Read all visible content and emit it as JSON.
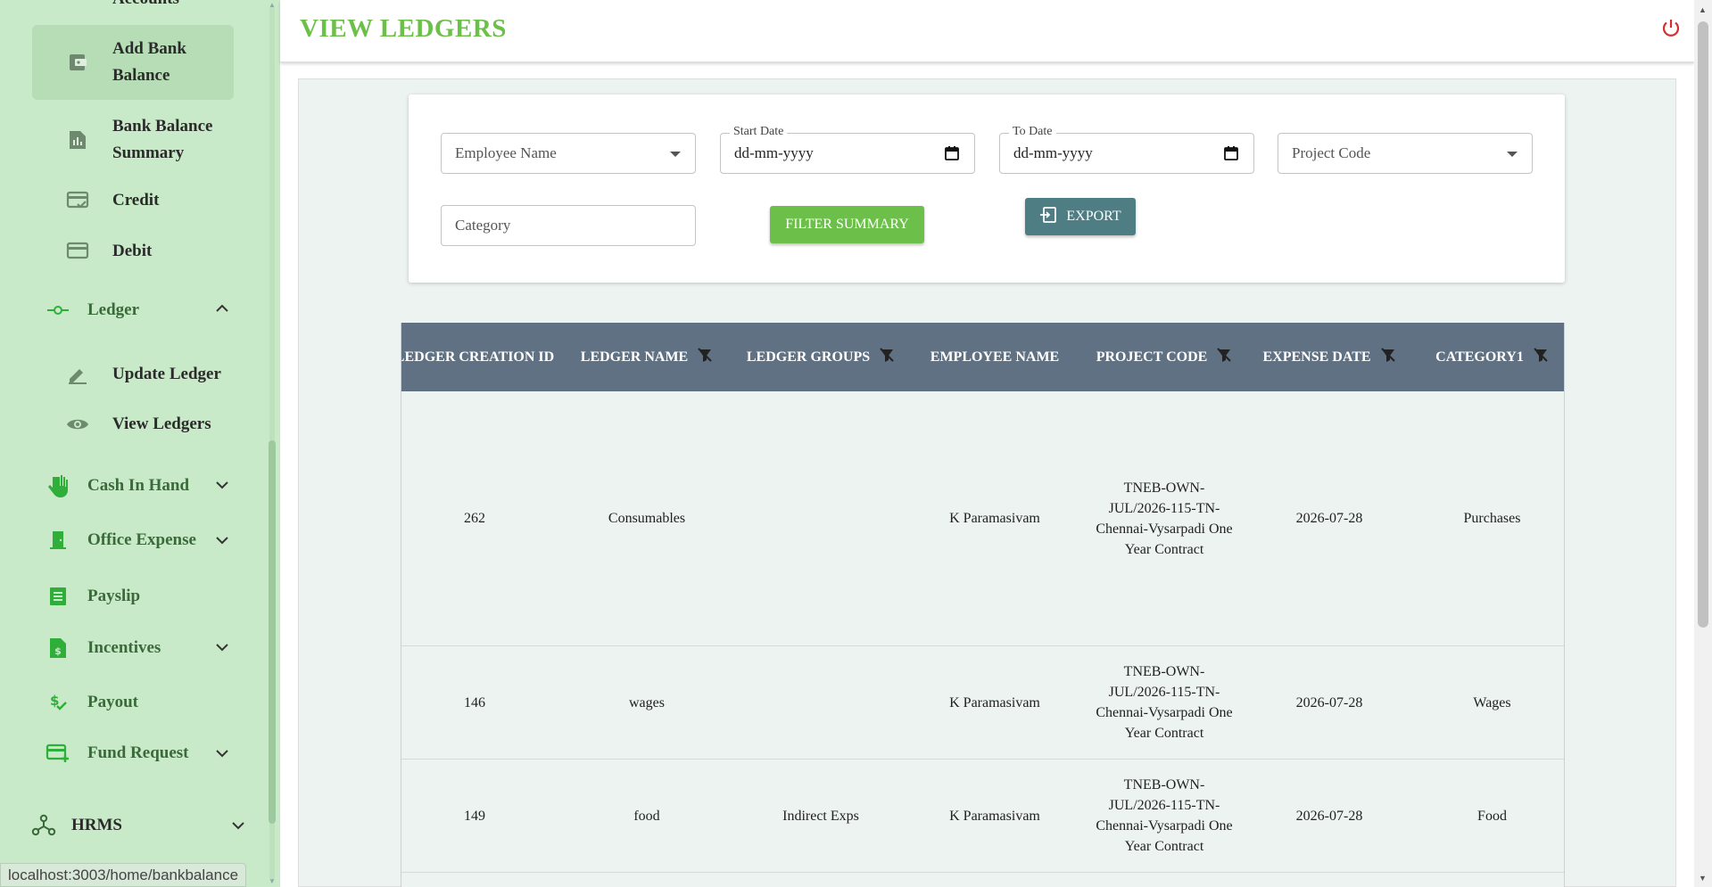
{
  "sidebar": {
    "items": [
      {
        "label": "Accounts",
        "icon": "accounts-icon"
      },
      {
        "label": "Add Bank Balance",
        "icon": "wallet-icon"
      },
      {
        "label": "Bank Balance Summary",
        "icon": "summary-icon"
      },
      {
        "label": "Credit",
        "icon": "credit-card-check-icon"
      },
      {
        "label": "Debit",
        "icon": "credit-card-icon"
      },
      {
        "label": "Ledger",
        "icon": "commit-icon"
      },
      {
        "label": "Update Ledger",
        "icon": "edit-icon"
      },
      {
        "label": "View Ledgers",
        "icon": "eye-icon"
      },
      {
        "label": "Cash In Hand",
        "icon": "hand-icon"
      },
      {
        "label": "Office Expense",
        "icon": "door-icon"
      },
      {
        "label": "Payslip",
        "icon": "receipt-icon"
      },
      {
        "label": "Incentives",
        "icon": "dollar-file-icon"
      },
      {
        "label": "Payout",
        "icon": "payout-icon"
      },
      {
        "label": "Fund Request",
        "icon": "card-plus-icon"
      },
      {
        "label": "HRMS",
        "icon": "people-network-icon"
      }
    ]
  },
  "status_url": "localhost:3003/home/bankbalance",
  "header": {
    "title": "VIEW LEDGERS",
    "power_icon": "power-icon"
  },
  "filters": {
    "employee_name": {
      "placeholder": "Employee Name"
    },
    "start_date": {
      "label": "Start Date",
      "value": "dd-mm-yyyy"
    },
    "to_date": {
      "label": "To Date",
      "value": "dd-mm-yyyy"
    },
    "project_code": {
      "placeholder": "Project Code"
    },
    "category": {
      "placeholder": "Category"
    },
    "filter_button": "FILTER SUMMARY",
    "export_button": "EXPORT"
  },
  "table": {
    "columns": [
      "LEDGER CREATION ID",
      "LEDGER NAME",
      "LEDGER GROUPS",
      "EMPLOYEE NAME",
      "PROJECT CODE",
      "EXPENSE DATE",
      "CATEGORY1"
    ],
    "rows": [
      {
        "id": "262",
        "name": "Consumables",
        "groups": "",
        "employee": "K Paramasivam",
        "project_lines": [
          "TNEB-OWN-",
          "JUL/2026-115-TN-",
          "Chennai-Vysarpadi One",
          "Year Contract"
        ],
        "date": "2026-07-28",
        "category": "Purchases"
      },
      {
        "id": "146",
        "name": "wages",
        "groups": "",
        "employee": "K Paramasivam",
        "project_lines": [
          "TNEB-OWN-",
          "JUL/2026-115-TN-",
          "Chennai-Vysarpadi One",
          "Year Contract"
        ],
        "date": "2026-07-28",
        "category": "Wages"
      },
      {
        "id": "149",
        "name": "food",
        "groups": "Indirect Exps",
        "employee": "K Paramasivam",
        "project_lines": [
          "TNEB-OWN-",
          "JUL/2026-115-TN-",
          "Chennai-Vysarpadi One",
          "Year Contract"
        ],
        "date": "2026-07-28",
        "category": "Food"
      }
    ]
  },
  "colors": {
    "accent_green": "#6cc04a",
    "header_bg": "#5f7182",
    "export_bg": "#4e7d84",
    "power": "#d32f2f",
    "sidebar_bg": "#c8eac8"
  }
}
